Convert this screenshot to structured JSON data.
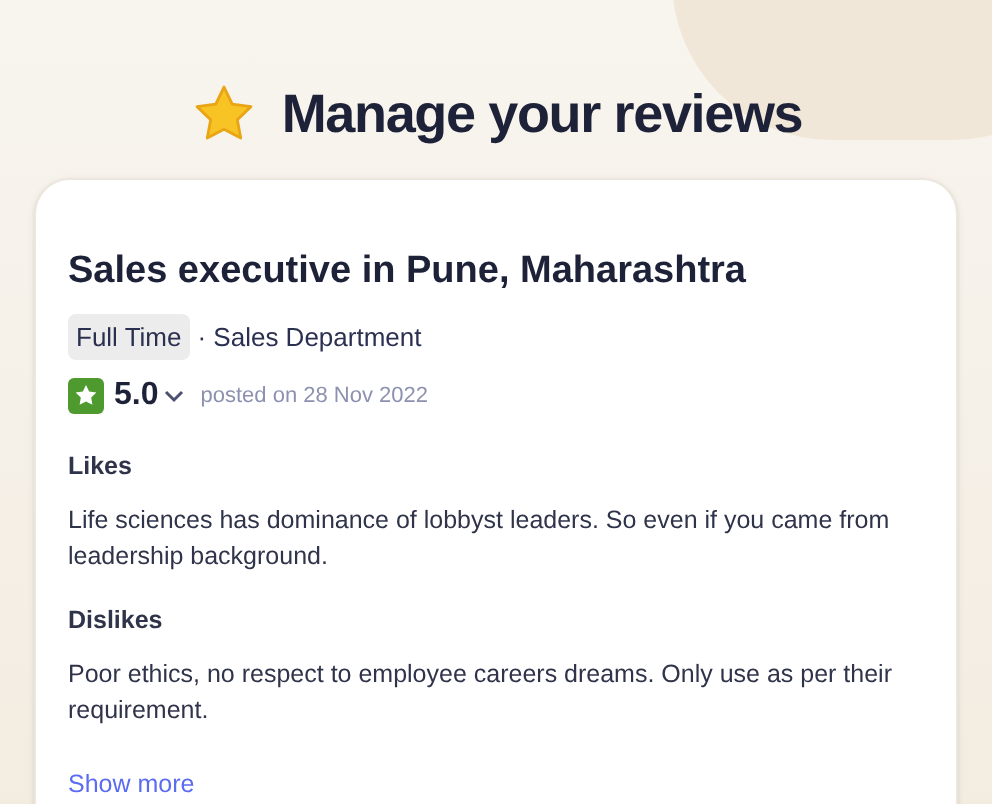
{
  "heading": "Manage your reviews",
  "review": {
    "title": "Sales executive in Pune, Maharashtra",
    "employment_type": "Full Time",
    "department": "· Sales Department",
    "rating": "5.0",
    "posted": "posted on 28 Nov 2022",
    "sections": [
      {
        "label": "Likes",
        "text": "Life sciences has dominance of lobbyst leaders. So even if you came from leadership background."
      },
      {
        "label": "Dislikes",
        "text": "Poor ethics, no respect to employee careers dreams. Only use as per their requirement."
      }
    ],
    "show_more": "Show more"
  }
}
